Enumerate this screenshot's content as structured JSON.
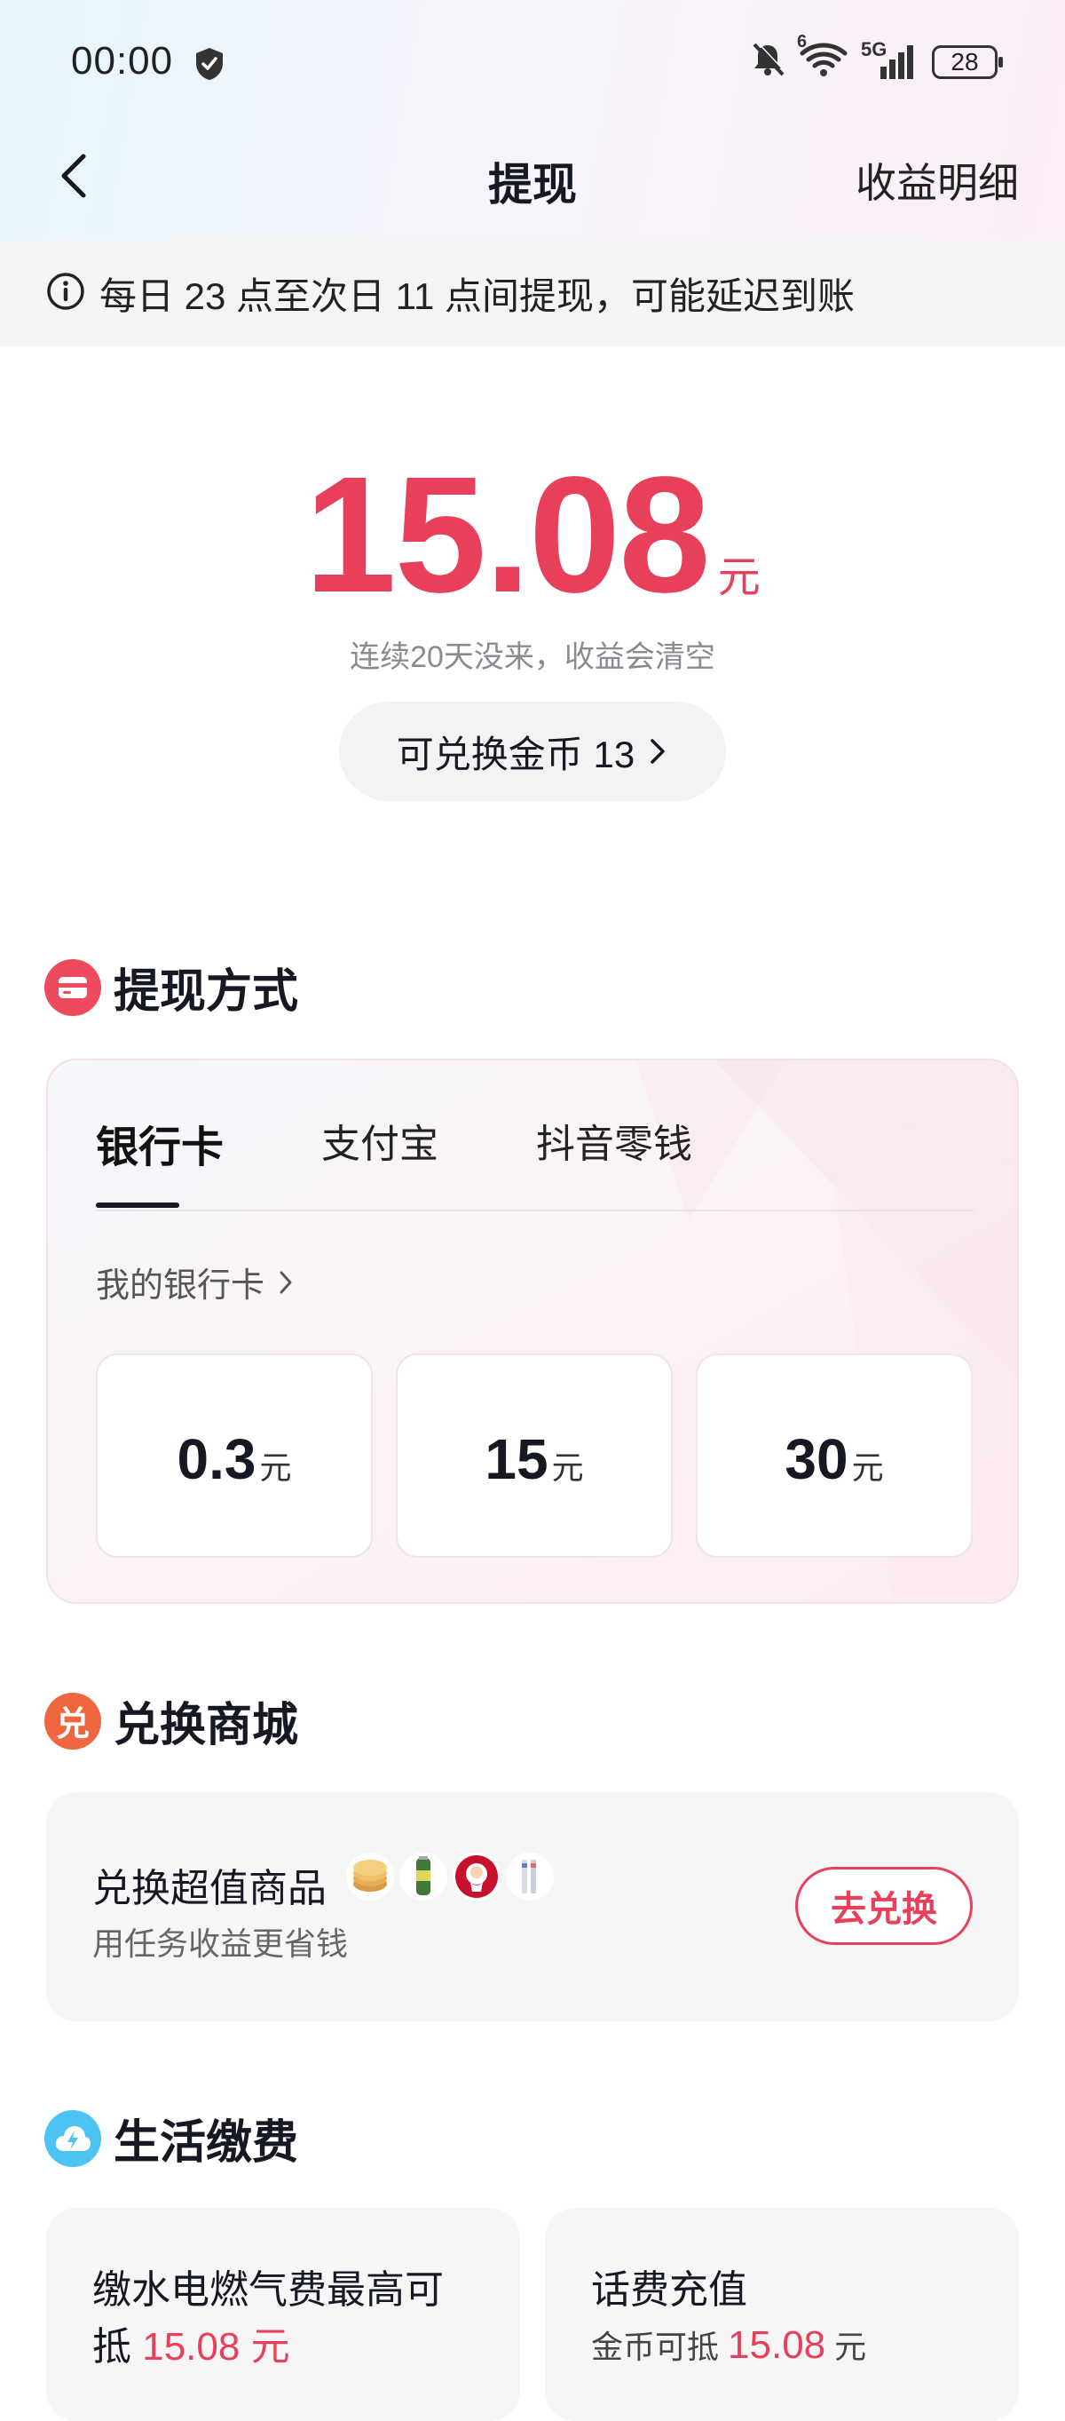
{
  "status_bar": {
    "time": "00:00",
    "network": "5G",
    "wifi_badge": "6",
    "battery": "28"
  },
  "nav": {
    "title": "提现",
    "right_link": "收益明细"
  },
  "notice": {
    "text": "每日 23 点至次日 11 点间提现，可能延迟到账"
  },
  "balance": {
    "amount": "15.08",
    "unit": "元",
    "warning": "连续20天没来，收益会清空",
    "coins_label": "可兑换金币 13"
  },
  "withdraw": {
    "section_title": "提现方式",
    "tabs": [
      {
        "label": "银行卡",
        "active": true
      },
      {
        "label": "支付宝",
        "active": false
      },
      {
        "label": "抖音零钱",
        "active": false
      }
    ],
    "my_card_link": "我的银行卡",
    "options": [
      {
        "value": "0.3",
        "unit": "元"
      },
      {
        "value": "15",
        "unit": "元"
      },
      {
        "value": "30",
        "unit": "元"
      }
    ]
  },
  "mall": {
    "section_title": "兑换商城",
    "icon_char": "兑",
    "title": "兑换超值商品",
    "subtitle": "用任务收益更省钱",
    "button": "去兑换"
  },
  "life": {
    "section_title": "生活缴费",
    "utility": {
      "line1": "缴水电燃气费最高可",
      "line2_prefix": "抵",
      "amount": "15.08 元"
    },
    "phone": {
      "title": "话费充值",
      "prefix": "金币可抵",
      "amount": "15.08",
      "unit": "元"
    }
  },
  "colors": {
    "accent": "#e8405a",
    "text": "#161823",
    "muted": "#8a8b91",
    "card_bg": "#f6f6f7"
  }
}
